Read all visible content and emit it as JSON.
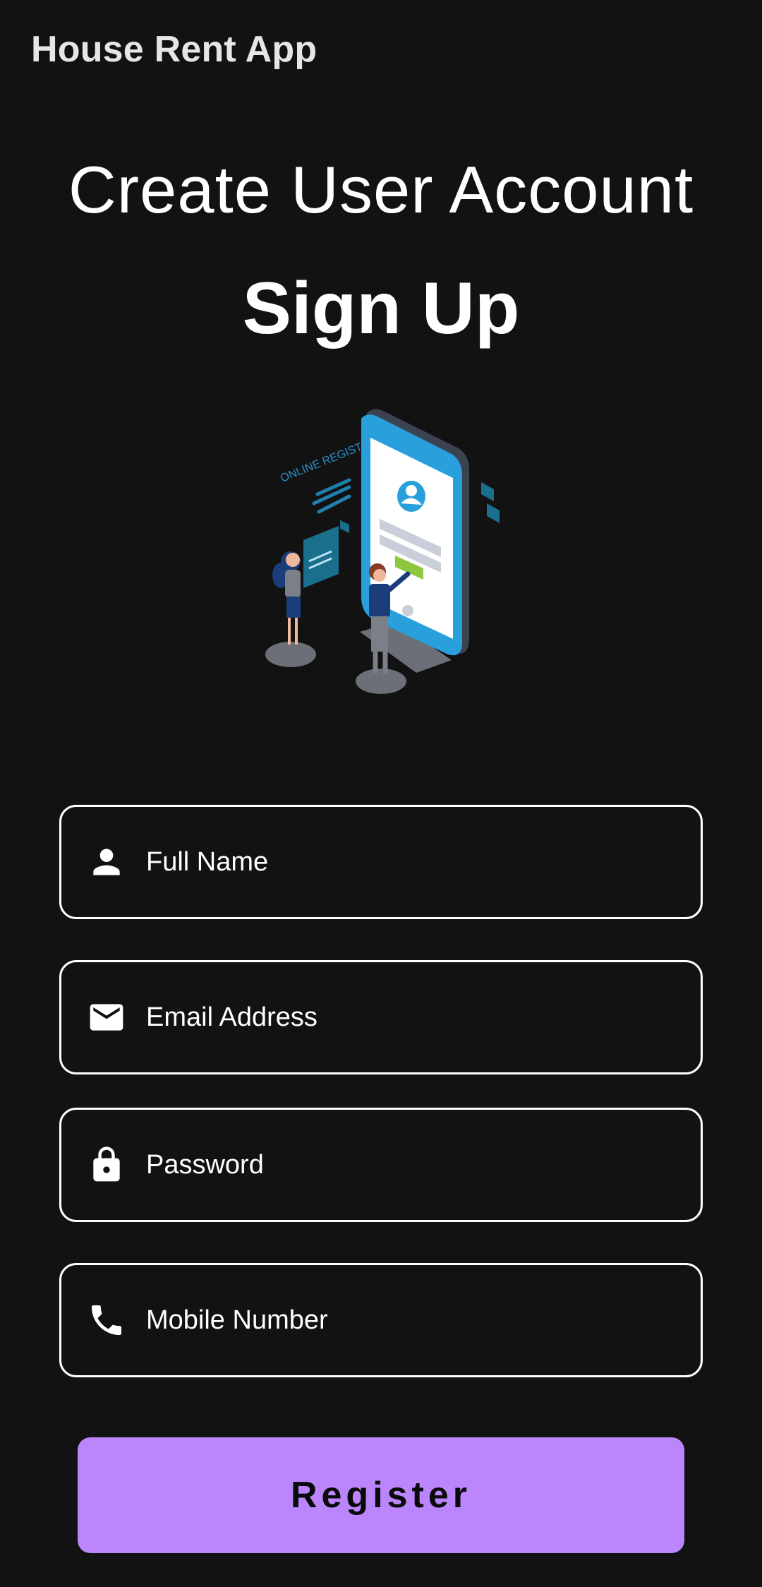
{
  "app_bar": {
    "title": "House Rent App"
  },
  "header": {
    "title": "Create User Account",
    "subtitle": "Sign Up"
  },
  "illustration": {
    "caption": "ONLINE REGISTRATION"
  },
  "form": {
    "fields": [
      {
        "icon": "person-icon",
        "placeholder": "Full Name"
      },
      {
        "icon": "email-icon",
        "placeholder": "Email Address"
      },
      {
        "icon": "lock-icon",
        "placeholder": "Password"
      },
      {
        "icon": "phone-icon",
        "placeholder": "Mobile Number"
      }
    ],
    "submit_label": "Register"
  },
  "colors": {
    "background": "#121212",
    "primary": "#bb86fc",
    "on_primary": "#0a0a0a",
    "outline": "#ffffff"
  }
}
